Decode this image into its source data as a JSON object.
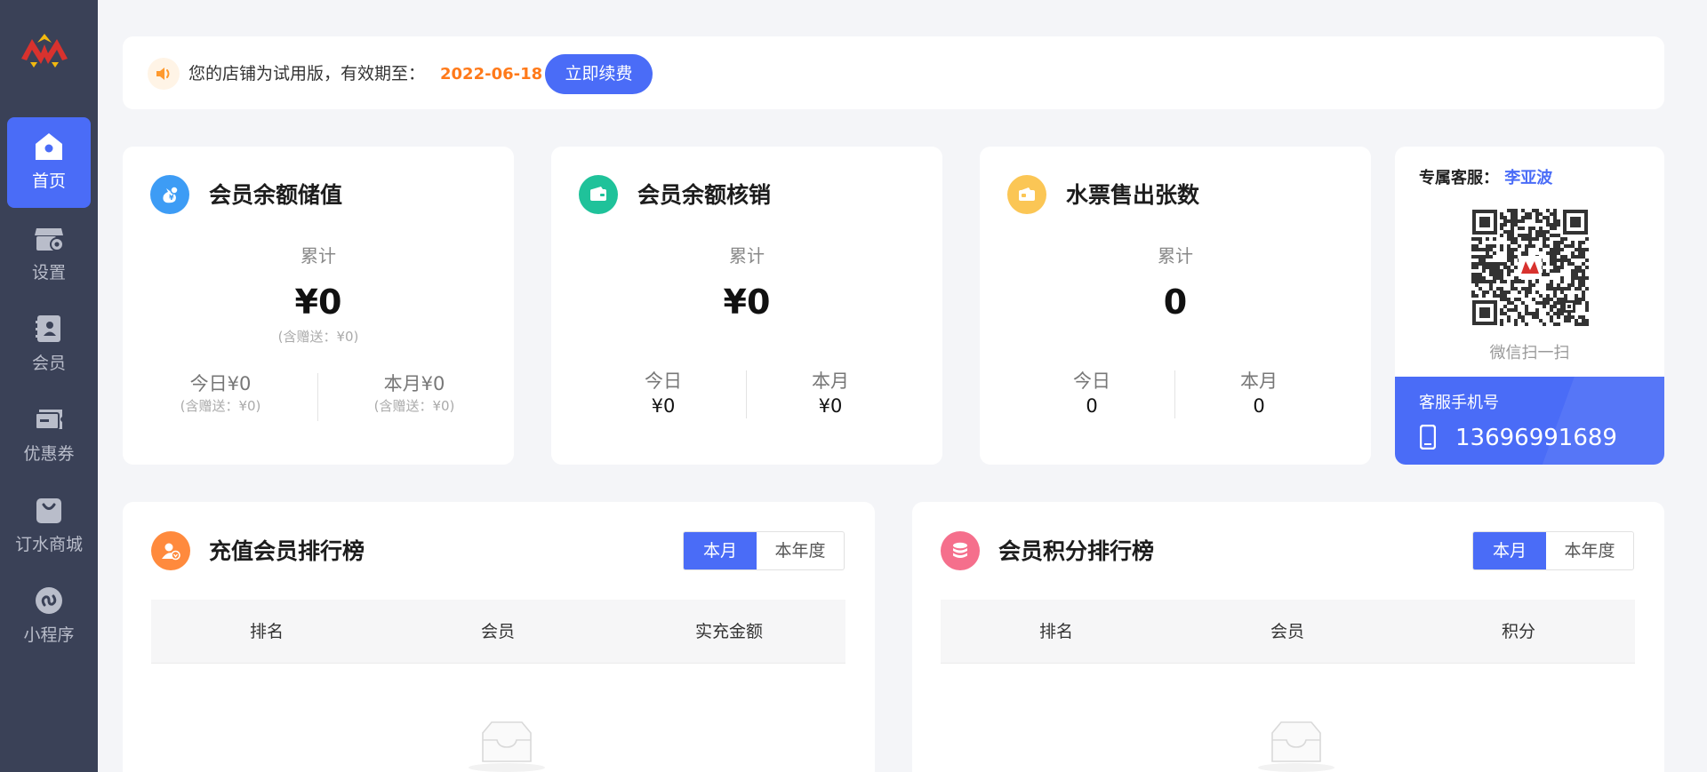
{
  "sidebar": {
    "items": [
      {
        "label": "首页",
        "icon": "home-icon",
        "active": true
      },
      {
        "label": "设置",
        "icon": "store-settings-icon"
      },
      {
        "label": "会员",
        "icon": "member-card-icon"
      },
      {
        "label": "优惠券",
        "icon": "coupon-icon"
      },
      {
        "label": "订水商城",
        "icon": "shopping-bag-icon"
      },
      {
        "label": "小程序",
        "icon": "mini-program-icon"
      }
    ]
  },
  "notice": {
    "text": "您的店铺为试用版，有效期至：",
    "date": "2022-06-18",
    "button": "立即续费"
  },
  "stats": [
    {
      "title": "会员余额储值",
      "icon_color": "#3d9cf5",
      "cumulative_label": "累计",
      "cumulative_value": "¥0",
      "cumulative_gift": "(含赠送：¥0)",
      "today": "今日¥0",
      "today_label": "今日",
      "today_value": "¥0",
      "today_gift": "(含赠送：¥0)",
      "month": "本月¥0",
      "month_label": "本月",
      "month_value": "¥0",
      "month_gift": "(含赠送：¥0)"
    },
    {
      "title": "会员余额核销",
      "icon_color": "#1fc29a",
      "cumulative_label": "累计",
      "cumulative_value": "¥0",
      "today_label": "今日",
      "today_value": "¥0",
      "month_label": "本月",
      "month_value": "¥0"
    },
    {
      "title": "水票售出张数",
      "icon_color": "#fbc655",
      "cumulative_label": "累计",
      "cumulative_value": "0",
      "today_label": "今日",
      "today_value": "0",
      "month_label": "本月",
      "month_value": "0"
    }
  ],
  "service": {
    "label": "专属客服：",
    "name": "李亚波",
    "scan_text": "微信扫一扫",
    "phone_label": "客服手机号",
    "phone": "13696991689"
  },
  "rankings": [
    {
      "title": "充值会员排行榜",
      "icon_color": "#ff8a3d",
      "tabs": [
        "本月",
        "本年度"
      ],
      "columns": [
        "排名",
        "会员",
        "实充金额"
      ]
    },
    {
      "title": "会员积分排行榜",
      "icon_color": "#f56f8c",
      "tabs": [
        "本月",
        "本年度"
      ],
      "columns": [
        "排名",
        "会员",
        "积分"
      ]
    }
  ],
  "colors": {
    "primary": "#4a6cf7",
    "sidebar_bg": "#3a4157",
    "date": "#ff7a1a"
  }
}
